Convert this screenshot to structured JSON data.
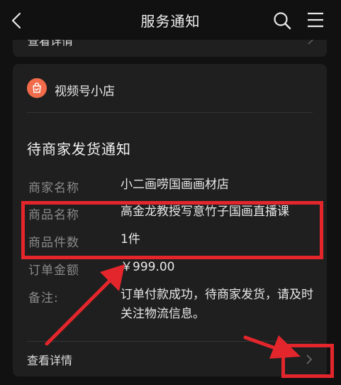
{
  "header": {
    "title": "服务通知"
  },
  "previous_card": {
    "view_details": "查看详情"
  },
  "card": {
    "shop_name": "视频号小店",
    "notice_title": "待商家发货通知",
    "rows": [
      {
        "label": "商家名称",
        "value": "小二画唠国画画材店"
      },
      {
        "label": "商品名称",
        "value": "高金龙教授写意竹子国画直播课"
      },
      {
        "label": "商品件数",
        "value": "1件"
      },
      {
        "label": "订单金额",
        "value": "￥999.00"
      },
      {
        "label": "备注:",
        "value": "订单付款成功，待商家发货，请及时关注物流信息。"
      }
    ],
    "view_details": "查看详情"
  },
  "colors": {
    "background": "#111111",
    "card": "#1f1f1f",
    "shop_logo": "#f26b4a",
    "annotation_red": "#e3262c"
  }
}
